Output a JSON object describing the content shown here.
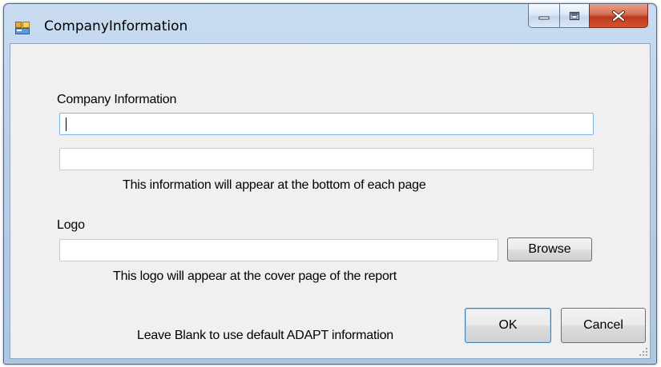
{
  "window": {
    "title": "CompanyInformation",
    "accent": "#c0391c"
  },
  "form": {
    "company_label": "Company Information",
    "company_line1_value": "",
    "company_line2_value": "",
    "company_hint": "This information will appear at the bottom of each page",
    "logo_label": "Logo",
    "logo_path_value": "",
    "browse_label": "Browse",
    "logo_hint": "This logo will appear at the cover page of the report",
    "blank_note": "Leave Blank to use default ADAPT information",
    "ok_label": "OK",
    "cancel_label": "Cancel"
  },
  "icons": {
    "app": "form-window-icon",
    "minimize": "minimize-icon",
    "maximize": "maximize-icon",
    "close": "close-icon",
    "grip": "resize-grip-icon"
  }
}
